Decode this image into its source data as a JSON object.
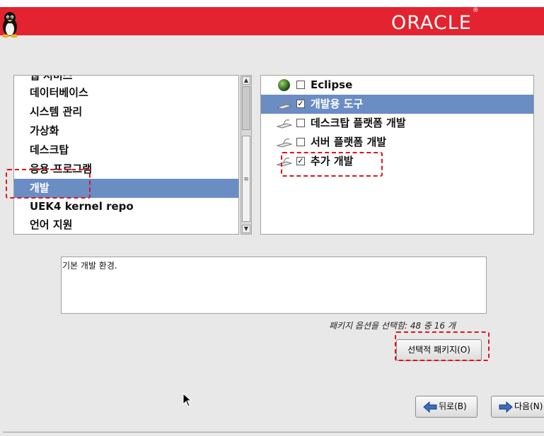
{
  "header": {
    "brand": "ORACLE",
    "trademark": "®",
    "mascot_icon": "tux-penguin-icon"
  },
  "categories": {
    "items": [
      {
        "label": "웹 서비스",
        "selected": false
      },
      {
        "label": "데이터베이스",
        "selected": false
      },
      {
        "label": "시스템 관리",
        "selected": false
      },
      {
        "label": "가상화",
        "selected": false
      },
      {
        "label": "데스크탑",
        "selected": false
      },
      {
        "label": "응용 프로그램",
        "selected": false
      },
      {
        "label": "개발",
        "selected": true
      },
      {
        "label": "UEK4 kernel repo",
        "selected": false
      },
      {
        "label": "언어 지원",
        "selected": false
      }
    ],
    "scrollbar_icon": "grip-icon"
  },
  "groups": {
    "items": [
      {
        "label": "Eclipse",
        "checked": false,
        "selected": false,
        "icon": "globe-icon",
        "check_mark": ""
      },
      {
        "label": "개발용 도구",
        "checked": true,
        "selected": true,
        "icon": "package-icon",
        "check_mark": "✓"
      },
      {
        "label": "데스크탑 플랫폼 개발",
        "checked": false,
        "selected": false,
        "icon": "package-icon",
        "check_mark": ""
      },
      {
        "label": "서버 플랫폼 개발",
        "checked": false,
        "selected": false,
        "icon": "package-icon",
        "check_mark": ""
      },
      {
        "label": "추가 개발",
        "checked": true,
        "selected": false,
        "icon": "package-icon",
        "check_mark": "✓"
      }
    ]
  },
  "description": "기본 개발 환경.",
  "package_count": "패키지 옵션을 선택함: 48 중 16 개",
  "buttons": {
    "optional": "선택적 패키지(O)",
    "back": "뒤로(B)",
    "next": "다음(N)"
  },
  "colors": {
    "banner": "#e3232f",
    "selection": "#6a8dc4",
    "highlight_dash": "#e0141c"
  }
}
